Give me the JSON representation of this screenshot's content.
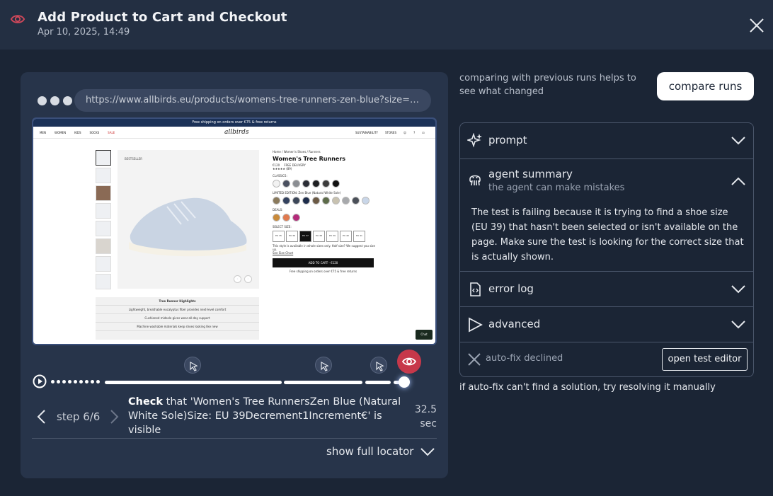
{
  "header": {
    "title": "Add Product to Cart and Checkout",
    "date": "Apr 10, 2025, 14:49",
    "eye_icon": "eye-icon",
    "close_icon": "close-icon"
  },
  "browser": {
    "url": "https://www.allbirds.eu/products/womens-tree-runners-zen-blue?size=e..."
  },
  "page_screenshot": {
    "banner": "Free shipping on orders over €75 & free returns",
    "nav_left": [
      "MEN",
      "WOMEN",
      "KIDS",
      "SOCKS",
      "SALE"
    ],
    "logo": "allbirds",
    "nav_right": [
      "SUSTAINABILITY",
      "STORES"
    ],
    "badge": "BESTSELLER",
    "breadcrumb": "Home / Women's Shoes / Runners",
    "product_name": "Women's Tree Runners",
    "price": "€120",
    "shipping_badge": "FREE DELIVERY",
    "rating": "★★★★★ (89)",
    "classics_label": "CLASSICS:",
    "limited_label": "LIMITED EDITION: Zen Blue (Natural White Sole)",
    "deals_label": "DEALS:",
    "size_label": "SELECT SIZE:",
    "sizes": [
      "EU 35",
      "EU 36",
      "EU 37",
      "EU 38",
      "EU 39",
      "EU 40",
      "EU 41"
    ],
    "selected_size_index": 2,
    "size_note": "This style is available in whole sizes only. Half size? We suggest you size up.",
    "size_chart": "See Size Chart",
    "add_to_cart": "ADD TO CART - €120",
    "free_ship_note": "Free shipping on orders over €75 & free returns",
    "highlights_title": "Tree Runner Highlights",
    "highlights": [
      "Lightweight, breathable eucalyptus fiber provides next-level comfort",
      "Cushioned midsole gives wear-all-day support",
      "Machine washable materials keep shoes looking like new"
    ],
    "chat": "Chat",
    "colors": {
      "classics": [
        "#f2f2f2",
        "#4a5060",
        "#8a8d92",
        "#2a2d35",
        "#1e1f22",
        "#3c3c3c",
        "#111111"
      ],
      "limited": [
        "#8a7a5c",
        "#33415e",
        "#3c4658",
        "#1d2c4a",
        "#6b5a45",
        "#5d6b4a",
        "#c8c2b0",
        "#a7a9ac",
        "#4a4f58",
        "#c9d6e8"
      ],
      "deals": [
        "#c98a3a",
        "#e07a4f",
        "#b42a7a"
      ]
    }
  },
  "timeline": {
    "current_step": "step 6/6",
    "step_action": "Check",
    "step_text": " that 'Women's Tree RunnersZen Blue (Natural White Sole)Size: EU 39Decrement1Increment€' is visible",
    "time_value": "32.5",
    "time_unit": "sec",
    "show_locator": "show full locator"
  },
  "right": {
    "compare_hint": "comparing with previous runs helps to see what changed",
    "compare_button": "compare runs",
    "prompt_label": "prompt",
    "agent_summary_label": "agent summary",
    "agent_summary_sub": "the agent can make mistakes",
    "agent_summary_text": "The test is failing because it is trying to find a shoe size (EU 39) that hasn't been selected or isn't available on the page. Make sure the test is looking for the correct size that is actually shown.",
    "error_log_label": "error log",
    "advanced_label": "advanced",
    "autofix_label": "auto-fix declined",
    "open_editor": "open test editor",
    "manual_hint": "if auto-fix can't find a solution, try resolving it manually"
  },
  "colors": {
    "background": "#1b2535",
    "header": "#232f42",
    "panel": "#27344a",
    "accent_red": "#c7384a"
  }
}
